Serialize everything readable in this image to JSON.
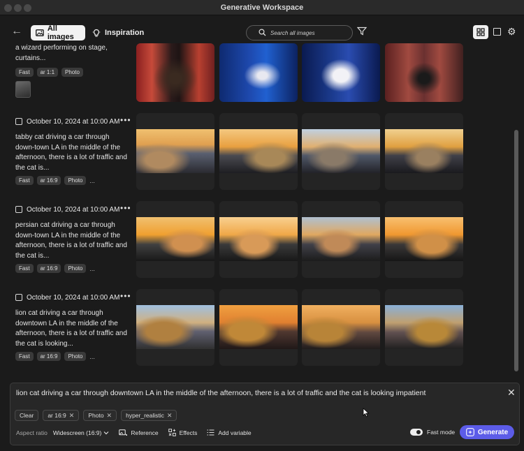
{
  "window": {
    "title": "Generative Workspace"
  },
  "toolbar": {
    "tabs": [
      {
        "label": "All images",
        "active": true,
        "icon": "image-icon"
      },
      {
        "label": "Inspiration",
        "active": false,
        "icon": "lightbulb-icon"
      }
    ],
    "search_placeholder": "Search all images"
  },
  "groups": [
    {
      "date": "",
      "prompt": "a wizard performing on stage, curtains...",
      "tags": [
        "Fast",
        "ar 1:1",
        "Photo"
      ],
      "has_reference": true,
      "images": [
        "wizard on red-curtained stage",
        "wizard in white on blue stage",
        "wizard in white robe on blue stage",
        "wizard silhouette with smoke"
      ]
    },
    {
      "date": "October 10, 2024 at 10:00 AM",
      "prompt": "tabby cat driving a car through down-town LA in the middle of the afternoon, there is a lot of traffic and the cat is...",
      "tags": [
        "Fast",
        "ar 16:9",
        "Photo"
      ],
      "images": [
        "tabby cat at wheel",
        "tabby cat in traffic",
        "tabby cat looking out",
        "tabby cat driving"
      ]
    },
    {
      "date": "October 10, 2024 at 10:00 AM",
      "prompt": "persian cat driving a car through down-town LA in the middle of the afternoon, there is a lot of traffic and the cat is...",
      "tags": [
        "Fast",
        "ar 16:9",
        "Photo"
      ],
      "images": [
        "persian cat at wheel",
        "persian cat in sunset",
        "persian cat in city",
        "persian cat driving"
      ]
    },
    {
      "date": "October 10, 2024 at 10:00 AM",
      "prompt": "lion cat driving a car through downtown LA in the middle of the afternoon, there is a lot of traffic and the cat is looking...",
      "tags": [
        "Fast",
        "ar 16:9",
        "Photo"
      ],
      "images": [
        "lion in car",
        "lion at sunset",
        "lion on road",
        "lion in traffic"
      ]
    }
  ],
  "composer": {
    "prompt": "lion cat driving a car through downtown LA in the middle of the afternoon, there is a lot of traffic and the cat is looking impatient",
    "clear_label": "Clear",
    "tags": [
      "ar 16:9",
      "Photo",
      "hyper_realistic"
    ],
    "aspect_ratio_label": "Aspect ratio",
    "aspect_ratio_value": "Widescreen (16:9)",
    "options": [
      "Reference",
      "Effects",
      "Add variable"
    ],
    "fast_mode_label": "Fast mode",
    "fast_mode_on": true,
    "generate_label": "Generate"
  },
  "colors": {
    "accent": "#5c5ce8",
    "background": "#1b1b1b"
  }
}
